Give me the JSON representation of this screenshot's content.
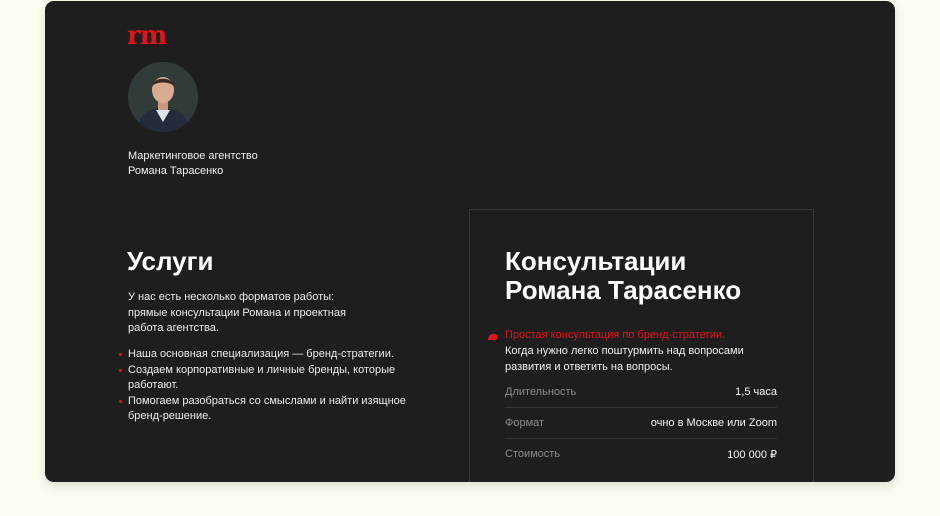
{
  "brand": {
    "logo_text": "rm",
    "accent_color": "#e0141c"
  },
  "agency": {
    "line1": "Маркетинговое агентство",
    "line2": "Романа Тарасенко"
  },
  "services": {
    "title": "Услуги",
    "intro": [
      "У нас есть несколько форматов работы:",
      "прямые консультации Романа и проектная",
      "работа агентства."
    ],
    "bullets": [
      "Наша основная специализация — бренд-стратегии.",
      "Создаем корпоративные и личные бренды, которые работают.",
      "Помогаем разобраться со смыслами и найти изящное бренд-решение."
    ]
  },
  "consultation": {
    "title_line1": "Консультации",
    "title_line2": "Романа Тарасенко",
    "highlight": "Простая консультация по бренд-стратегии.",
    "description": "Когда нужно легко поштурмить над вопросами развития и ответить на вопросы.",
    "details": [
      {
        "label": "Длительность",
        "value": "1,5 часа"
      },
      {
        "label": "Формат",
        "value": "очно в Москве или Zoom"
      },
      {
        "label": "Стоимость",
        "value": "100 000 ₽"
      }
    ]
  }
}
